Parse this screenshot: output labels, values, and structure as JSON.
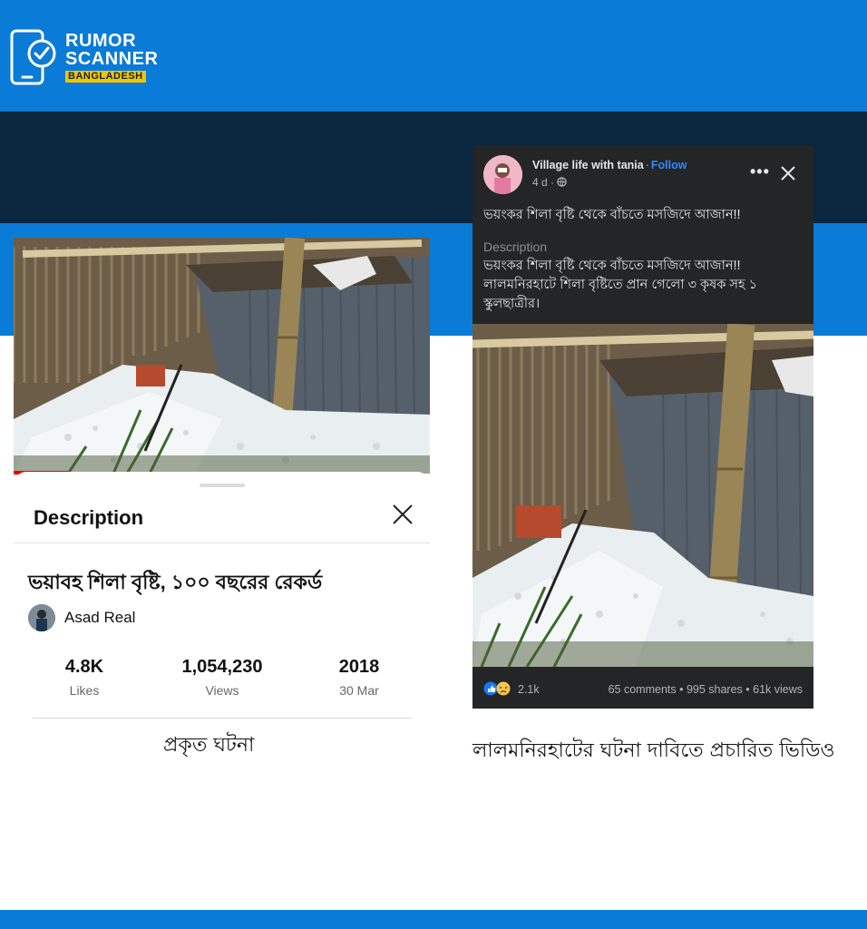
{
  "brand": {
    "line1": "RUMOR",
    "line2": "SCANNER",
    "line3": "BANGLADESH"
  },
  "youtube": {
    "panel_heading": "Description",
    "video_title": "ভয়াবহ শিলা বৃষ্টি, ১০০ বছরের রেকর্ড",
    "channel": "Asad Real",
    "stats": [
      {
        "value": "4.8K",
        "label": "Likes"
      },
      {
        "value": "1,054,230",
        "label": "Views"
      },
      {
        "value": "2018",
        "label": "30 Mar"
      }
    ],
    "progress_fraction": 0.13
  },
  "caption_left": "প্রকৃত ঘটনা",
  "facebook": {
    "page_name": "Village life with tania",
    "follow": "Follow",
    "time": "4 d ·",
    "post_text": "ভয়ংকর শিলা বৃষ্টি থেকে বাঁচতে  মসজিদে আজান!!",
    "description_heading": "Description",
    "description_line1": "ভয়ংকর শিলা বৃষ্টি থেকে বাঁচতে  মসজিদে আজান!!",
    "description_line2": "লালমনিরহাটে শিলা বৃষ্টিতে প্রান গেলো ৩ কৃষক সহ ১ স্কুলছাত্রীর।",
    "reactions_count": "2.1k",
    "stats": "65 comments • 995 shares • 61k views"
  },
  "caption_right": "লালমনিরহাটের ঘটনা দাবিতে প্রচারিত ভিডিও",
  "colors": {
    "brand_blue": "#0a7bd6",
    "navy": "#0b2740",
    "fb_dark": "#242526",
    "fb_link": "#2d88ff",
    "yt_red": "#ff0000",
    "logo_yellow": "#f5c400"
  }
}
